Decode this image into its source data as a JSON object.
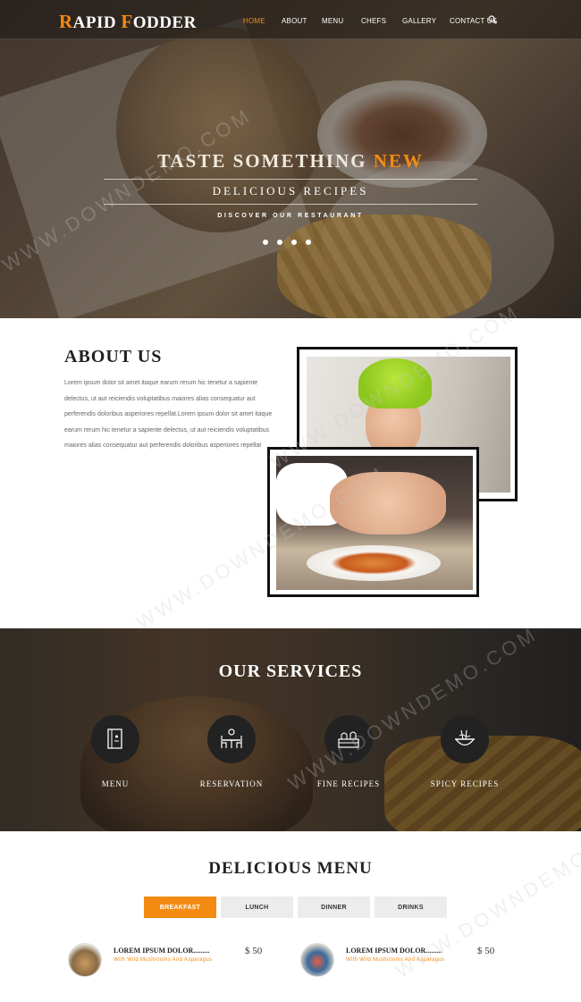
{
  "brand": {
    "logo_first_cap": "R",
    "logo_first_rest": "APID ",
    "logo_second_cap": "F",
    "logo_second_rest": "ODDER"
  },
  "nav": {
    "items": [
      {
        "label": "HOME",
        "active": true
      },
      {
        "label": "ABOUT",
        "active": false
      },
      {
        "label": "MENU",
        "active": false
      },
      {
        "label": "CHEFS",
        "active": false
      },
      {
        "label": "GALLERY",
        "active": false
      },
      {
        "label": "CONTACT US",
        "active": false
      }
    ],
    "search_icon": "search-icon"
  },
  "hero": {
    "title_main": "TASTE SOMETHING ",
    "title_accent": "NEW",
    "subtitle": "DELICIOUS RECIPES",
    "tagline": "DISCOVER OUR RESTAURANT",
    "slide_count": 4
  },
  "about": {
    "title": "ABOUT US",
    "lines": [
      "Lorem ipsum dolor sit amet itaque earum rerum hic tenetur a sapiente",
      "delectus, ut aut reiciendis voluptatibus maiores alias consequatur aut",
      "perferendis doloribus asperiores repellat.Lorem ipsum dolor sit amet itaque",
      "earum rerum hic tenetur a sapiente delectus, ut aut reiciendis voluptatibus",
      "maiores alias consequatur aut perferendis doloribus asperiores repellat"
    ]
  },
  "services": {
    "title": "OUR SERVICES",
    "items": [
      {
        "label": "MENU",
        "icon": "menu-book-icon"
      },
      {
        "label": "RESERVATION",
        "icon": "reservation-table-icon"
      },
      {
        "label": "FINE RECIPES",
        "icon": "fine-recipes-icon"
      },
      {
        "label": "SPICY RECIPES",
        "icon": "noodle-bowl-icon"
      }
    ]
  },
  "menu": {
    "title": "DELICIOUS MENU",
    "tabs": [
      {
        "label": "BREAKFAST",
        "active": true
      },
      {
        "label": "LUNCH",
        "active": false
      },
      {
        "label": "DINNER",
        "active": false
      },
      {
        "label": "DRINKS",
        "active": false
      }
    ],
    "dishes": [
      {
        "name": "LOREM IPSUM DOLOR.........",
        "desc": "With Wild Mushrooms And Asparagus",
        "price": "$ 50"
      },
      {
        "name": "LOREM IPSUM DOLOR.........",
        "desc": "With Wild Mushrooms And Asparagus",
        "price": "$ 50"
      }
    ]
  },
  "colors": {
    "accent": "#f38b12",
    "dark": "#222222"
  },
  "watermark": "WWW.DOWNDEMO.COM"
}
